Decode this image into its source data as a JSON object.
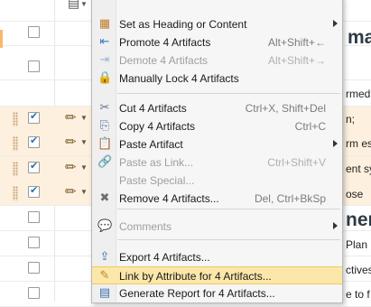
{
  "background": {
    "heading_fragments": [
      {
        "text": "ma"
      },
      {
        "text": "nen"
      }
    ],
    "text_fragments": [
      {
        "text": "rmed"
      },
      {
        "text": "n;"
      },
      {
        "text": "rm es"
      },
      {
        "text": "ent sy"
      },
      {
        "text": "ose"
      },
      {
        "text": "Plan"
      },
      {
        "text": "ctives"
      },
      {
        "text": "e to f"
      }
    ]
  },
  "menu": {
    "items": [
      {
        "label": "Set as Heading or Content",
        "shortcut": "",
        "icon": "heading-content-icon",
        "glyph": "▦",
        "color": "#c27b2a",
        "disabled": false,
        "submenu": true,
        "hover": false
      },
      {
        "label": "Promote 4 Artifacts",
        "shortcut": "Alt+Shift+←",
        "icon": "promote-icon",
        "glyph": "⇤",
        "color": "#3a7ac9",
        "disabled": false,
        "submenu": false,
        "hover": false
      },
      {
        "label": "Demote 4 Artifacts",
        "shortcut": "Alt+Shift+→",
        "icon": "demote-icon",
        "glyph": "⇥",
        "color": "#9bb8de",
        "disabled": true,
        "submenu": false,
        "hover": false
      },
      {
        "label": "Manually Lock 4 Artifacts",
        "shortcut": "",
        "icon": "lock-icon",
        "glyph": "🔒",
        "color": "#d4a020",
        "disabled": false,
        "submenu": false,
        "hover": false
      },
      {
        "label": "Cut 4 Artifacts",
        "shortcut": "Ctrl+X, Shift+Del",
        "icon": "cut-icon",
        "glyph": "✂",
        "color": "#5a6f8a",
        "disabled": false,
        "submenu": false,
        "hover": false
      },
      {
        "label": "Copy 4 Artifacts",
        "shortcut": "Ctrl+C",
        "icon": "copy-icon",
        "glyph": "⎘",
        "color": "#4d6f9e",
        "disabled": false,
        "submenu": false,
        "hover": false
      },
      {
        "label": "Paste Artifact",
        "shortcut": "",
        "icon": "paste-icon",
        "glyph": "📋",
        "color": "#c9912d",
        "disabled": false,
        "submenu": true,
        "hover": false
      },
      {
        "label": "Paste as Link...",
        "shortcut": "Ctrl+Shift+V",
        "icon": "paste-link-icon",
        "glyph": "🔗",
        "color": "#c9a66b",
        "disabled": true,
        "submenu": false,
        "hover": false
      },
      {
        "label": "Paste Special...",
        "shortcut": "",
        "icon": "paste-special-icon",
        "glyph": "",
        "color": "#999999",
        "disabled": true,
        "submenu": false,
        "hover": false
      },
      {
        "label": "Remove 4 Artifacts...",
        "shortcut": "Del, Ctrl+BkSp",
        "icon": "remove-icon",
        "glyph": "✖",
        "color": "#6e6e6e",
        "disabled": false,
        "submenu": false,
        "hover": false
      },
      {
        "label": "Comments",
        "shortcut": "",
        "icon": "comments-icon",
        "glyph": "💬",
        "color": "#7aa0c8",
        "disabled": true,
        "submenu": true,
        "hover": false
      },
      {
        "label": "Export 4 Artifacts...",
        "shortcut": "",
        "icon": "export-icon",
        "glyph": "⇪",
        "color": "#3f6fa8",
        "disabled": false,
        "submenu": false,
        "hover": false
      },
      {
        "label": "Link by Attribute for 4 Artifacts...",
        "shortcut": "",
        "icon": "link-attribute-icon",
        "glyph": "✎",
        "color": "#b88a2a",
        "disabled": false,
        "submenu": false,
        "hover": true
      },
      {
        "label": "Generate Report for 4 Artifacts...",
        "shortcut": "",
        "icon": "report-icon",
        "glyph": "▤",
        "color": "#3a6db0",
        "disabled": false,
        "submenu": false,
        "hover": false
      }
    ]
  }
}
